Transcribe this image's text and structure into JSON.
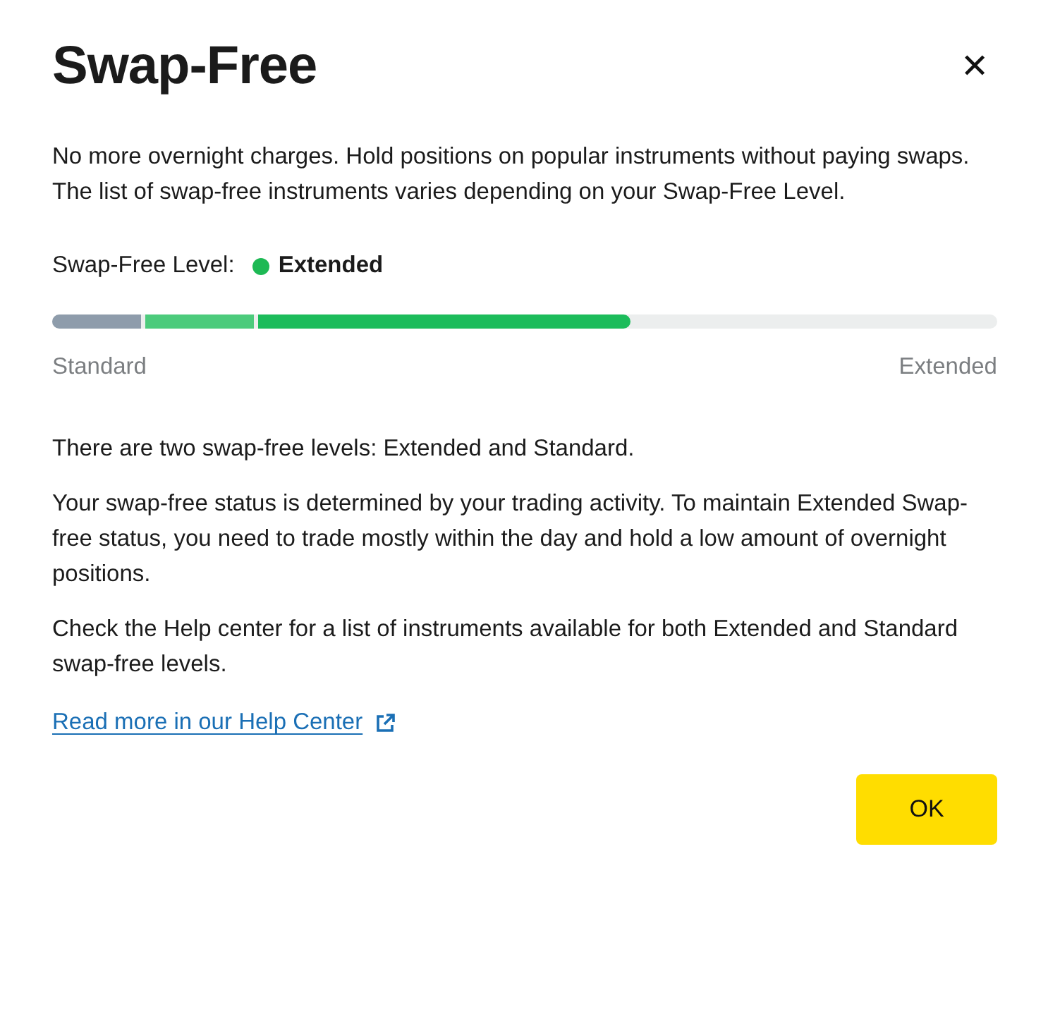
{
  "dialog": {
    "title": "Swap-Free",
    "close_icon": "✕"
  },
  "intro": "No more overnight charges. Hold positions on popular instruments without paying swaps. The list of swap-free instruments varies depending on your Swap-Free Level.",
  "level_status": {
    "label": "Swap-Free Level:",
    "value": "Extended",
    "color": "#1db954"
  },
  "progress": {
    "segments": [
      {
        "color": "#8e9cab",
        "level": 0.094
      },
      {
        "color": "#4ccb7c",
        "level": 0.115
      },
      {
        "color": "#1cbc5b",
        "level": 0.394
      }
    ],
    "min_label": "Standard",
    "max_label": "Extended"
  },
  "paragraphs": [
    "There are two swap-free levels: Extended and Standard.",
    "Your swap-free status is determined by your trading activity. To maintain Extended Swap-free status, you need to trade mostly within the day and hold a low amount of overnight positions.",
    "Check the Help center for a list of instruments available for both Extended and Standard swap-free levels."
  ],
  "link": "Read more in our Help Center",
  "buttons": [
    "OK"
  ]
}
